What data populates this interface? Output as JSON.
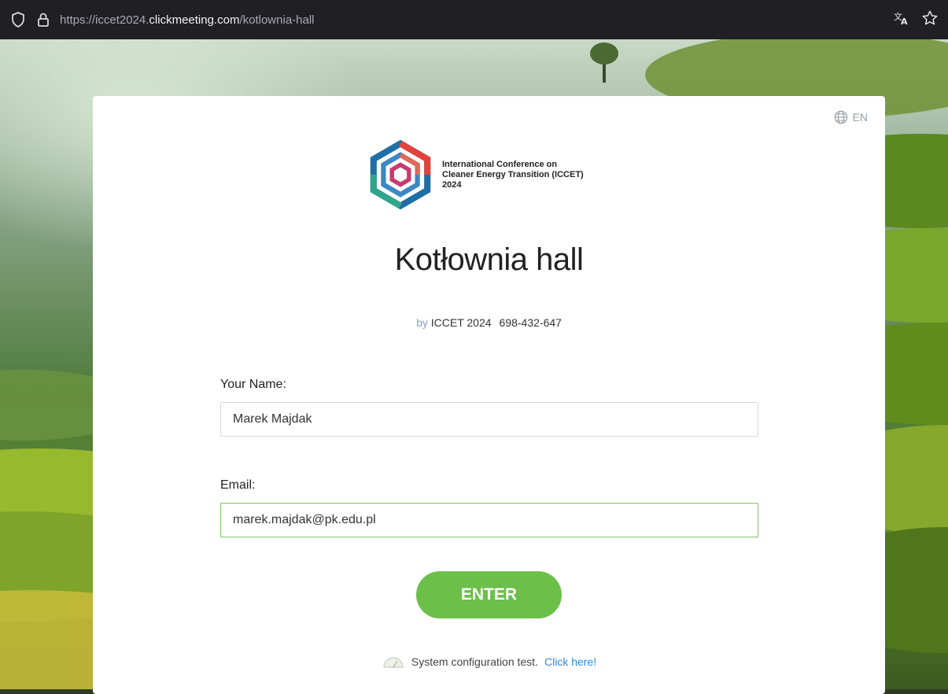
{
  "browser": {
    "url_prefix": "https://iccet2024.",
    "url_domain": "clickmeeting.com",
    "url_path": "/kotlownia-hall"
  },
  "card": {
    "language": "EN",
    "logo_text": [
      "International Conference on",
      "Cleaner Energy Transition (ICCET)",
      "2024"
    ],
    "title": "Kotłownia hall",
    "by_label": "by",
    "organizer": "ICCET 2024",
    "room_id": "698-432-647",
    "name_label": "Your Name:",
    "name_value": "Marek Majdak",
    "email_label": "Email:",
    "email_value": "marek.majdak@pk.edu.pl",
    "enter_label": "ENTER",
    "systest_text": "System configuration test.",
    "systest_link": "Click here!"
  },
  "colors": {
    "accent_green": "#6cc04a",
    "link_blue": "#2e8ae0",
    "input_focus": "#7cc45a"
  },
  "icons": [
    "shield-icon",
    "lock-icon",
    "translate-icon",
    "bookmark-star-icon",
    "globe-icon",
    "speedometer-icon"
  ]
}
